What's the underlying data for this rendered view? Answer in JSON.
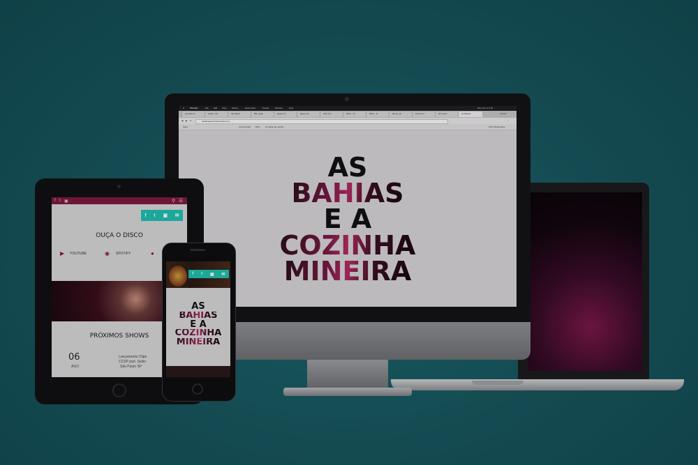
{
  "band_title": {
    "line1": "AS",
    "line2": "BAHIAS",
    "line3": "E A",
    "line4": "COZINHA",
    "line5": "MINEIRA"
  },
  "browser": {
    "app_menu": "Chrome",
    "menus": [
      "File",
      "Edit",
      "View",
      "History",
      "Bookmarks",
      "People",
      "Window",
      "Help"
    ],
    "clock": "Mon Oct 17  2:01",
    "tabs": [
      "animate.cs",
      "load3 - Oh",
      "3D Glyph",
      "BD+ jQue",
      "jQuery Sl",
      "jQuery Sc",
      "Shot Sto",
      "Mess - Ju",
      "Mkte - Ju",
      "08_10_ac",
      "Zoomix H",
      "(2) Listen",
      "As Bahias"
    ],
    "url": "asbahiasacozinhamineira.com",
    "bookmarks": [
      "Apps",
      "ChromeCast",
      "DIFs",
      "13 ideias de monitil..."
    ],
    "other_bookmarks": "Other Bookmarks",
    "user": "Lorena"
  },
  "tablet": {
    "listen_heading": "OUÇA O DISCO",
    "platforms": [
      "YOUTUBE",
      "SPOTIFY",
      ""
    ],
    "shows_heading": "PRÓXIMOS SHOWS",
    "show_day": "06",
    "show_month": "AGO",
    "show_line1": "Lançamento Clipe",
    "show_line2": "CCSP part. Seiko",
    "show_line3": "São Paulo SP"
  },
  "social_icons": [
    "facebook-icon",
    "twitter-icon",
    "instagram-icon",
    "email-icon"
  ],
  "colors": {
    "background": "#1a5c64",
    "accent_teal": "#1fc0b0",
    "header_wine": "#7d1a40",
    "screen_bg": "#d6d4d6",
    "title_dark": "#121114"
  }
}
